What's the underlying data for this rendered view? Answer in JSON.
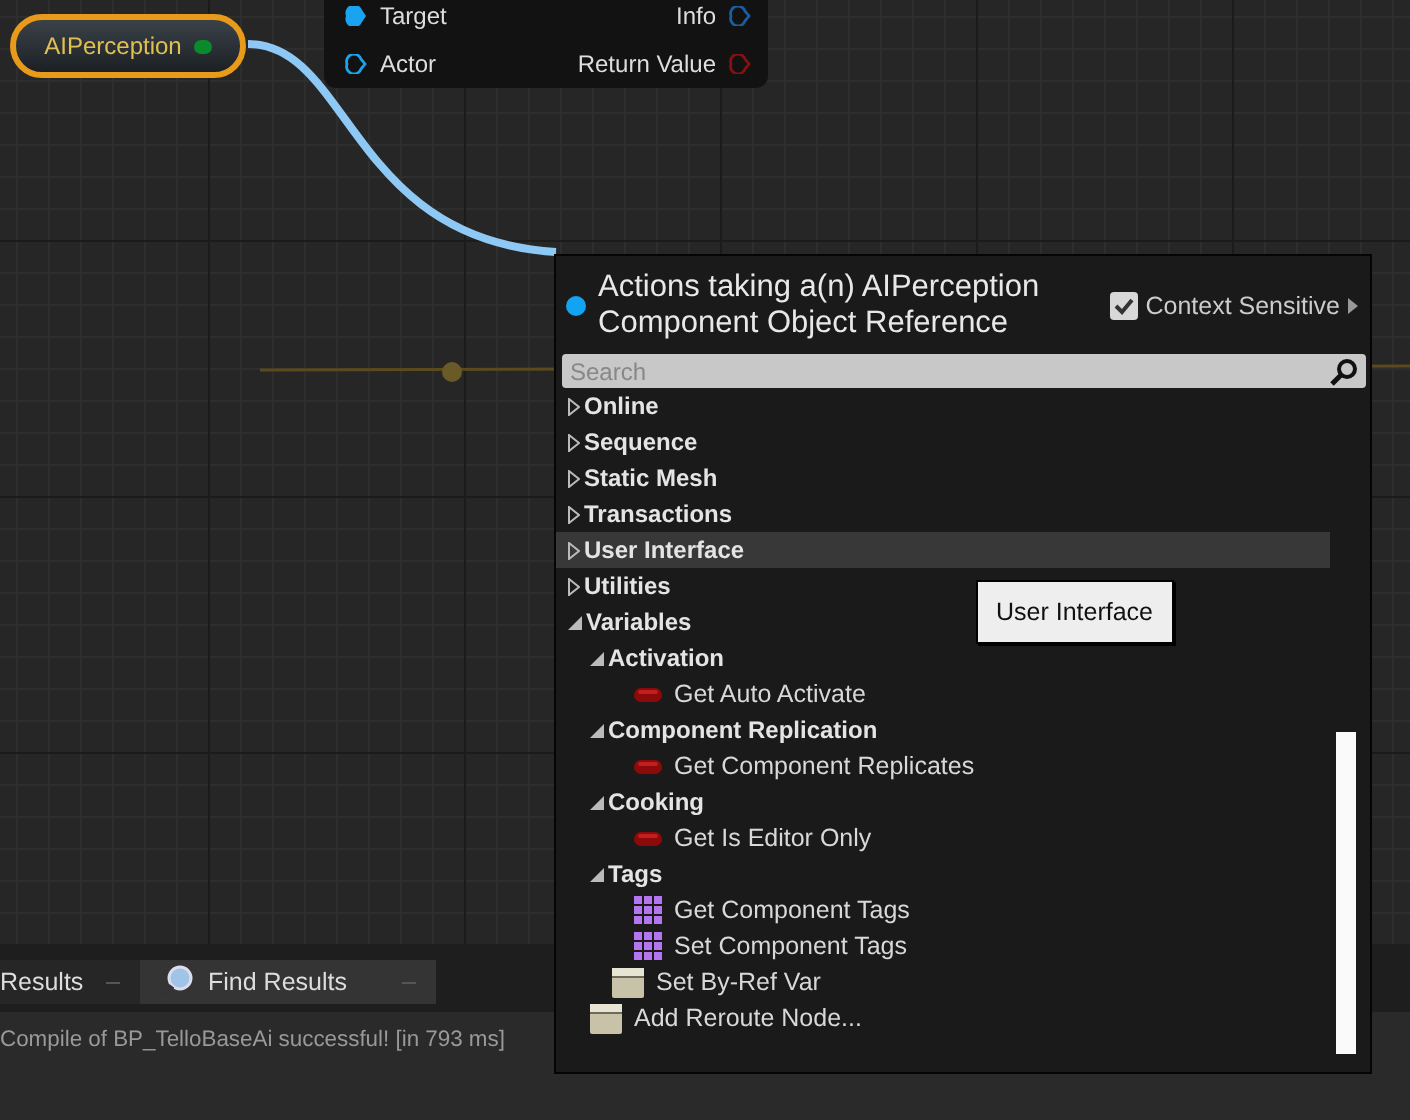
{
  "graph": {
    "source_node": {
      "title": "AIPerception"
    },
    "function_node": {
      "inputs": [
        {
          "label": "Target",
          "connected": true,
          "color": "#1aa3f0"
        },
        {
          "label": "Actor",
          "connected": false,
          "color": "#1aa3f0"
        }
      ],
      "outputs": [
        {
          "label": "Info",
          "connected": false,
          "color": "#1a5ea0"
        },
        {
          "label": "Return Value",
          "connected": false,
          "color": "#8a1010"
        }
      ]
    }
  },
  "action_menu": {
    "title": "Actions taking a(n) AIPerception Component Object Reference",
    "context_sensitive": {
      "label": "Context Sensitive",
      "checked": true
    },
    "search": {
      "placeholder": "Search"
    },
    "items": [
      {
        "kind": "category",
        "label": "Online",
        "expanded": false,
        "selected": false
      },
      {
        "kind": "category",
        "label": "Sequence",
        "expanded": false,
        "selected": false
      },
      {
        "kind": "category",
        "label": "Static Mesh",
        "expanded": false,
        "selected": false
      },
      {
        "kind": "category",
        "label": "Transactions",
        "expanded": false,
        "selected": false
      },
      {
        "kind": "category",
        "label": "User Interface",
        "expanded": false,
        "selected": true
      },
      {
        "kind": "category",
        "label": "Utilities",
        "expanded": false,
        "selected": false
      },
      {
        "kind": "category",
        "label": "Variables",
        "expanded": true,
        "selected": false,
        "children": [
          {
            "kind": "category",
            "label": "Activation",
            "expanded": true,
            "selected": false,
            "children": [
              {
                "kind": "boolean",
                "label": "Get Auto Activate",
                "selected": false
              }
            ]
          },
          {
            "kind": "category",
            "label": "Component Replication",
            "expanded": true,
            "selected": false,
            "children": [
              {
                "kind": "boolean",
                "label": "Get Component Replicates",
                "selected": false
              }
            ]
          },
          {
            "kind": "category",
            "label": "Cooking",
            "expanded": true,
            "selected": false,
            "children": [
              {
                "kind": "boolean",
                "label": "Get Is Editor Only",
                "selected": false
              }
            ]
          },
          {
            "kind": "category",
            "label": "Tags",
            "expanded": true,
            "selected": false,
            "children": [
              {
                "kind": "array",
                "label": "Get Component Tags",
                "selected": false
              },
              {
                "kind": "array",
                "label": "Set Component Tags",
                "selected": false
              }
            ]
          },
          {
            "kind": "node",
            "label": "Set By-Ref Var",
            "selected": false
          }
        ]
      },
      {
        "kind": "node",
        "label": "Add Reroute Node...",
        "selected": false
      }
    ],
    "tooltip": "User Interface"
  },
  "bottom_panel": {
    "tabs": [
      {
        "label": "Results",
        "selected": false
      },
      {
        "label": "Find Results",
        "selected": true
      }
    ],
    "message": "Compile of BP_TelloBaseAi successful! [in 793 ms]"
  }
}
